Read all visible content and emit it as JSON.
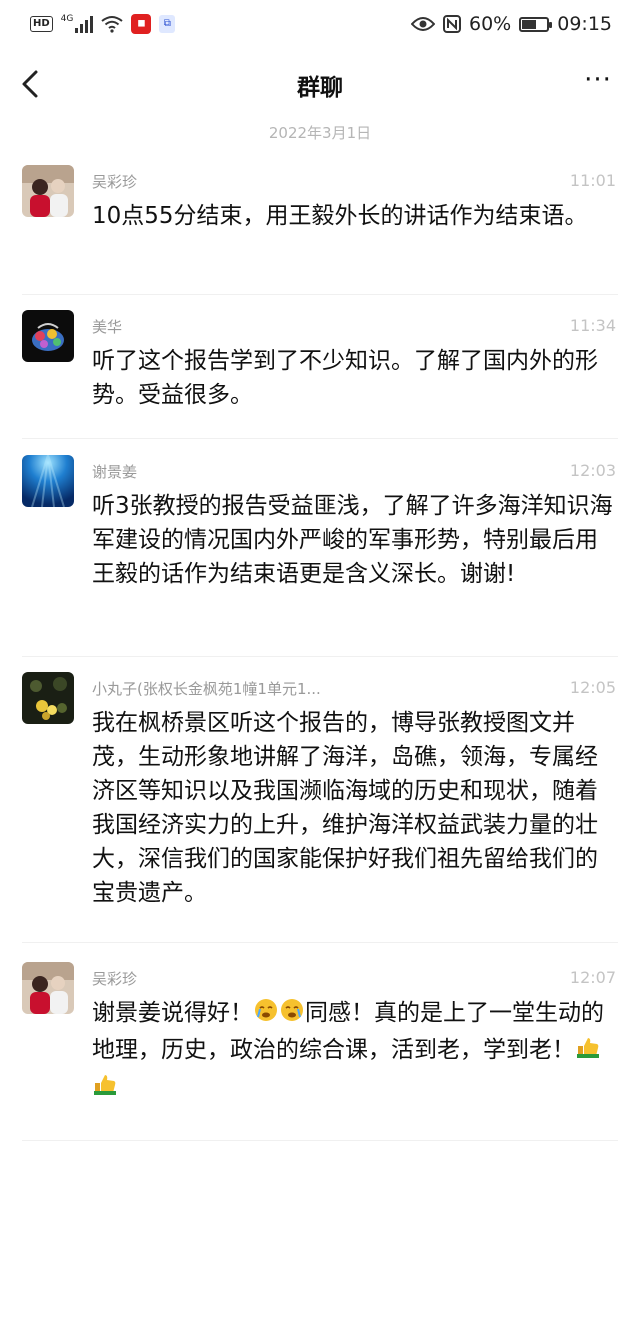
{
  "status_bar": {
    "hd_badge": "HD",
    "network": "4G",
    "battery_pct": "60%",
    "time": "09:15",
    "battery_level": 0.6
  },
  "nav": {
    "title": "群聊",
    "more": "···"
  },
  "date_separator": "2022年3月1日",
  "messages": [
    {
      "sender": "吴彩珍",
      "time": "11:01",
      "text": "10点55分结束，用王毅外长的讲话作为结束语。"
    },
    {
      "sender": "美华",
      "time": "11:34",
      "text": "听了这个报告学到了不少知识。了解了国内外的形势。受益很多。"
    },
    {
      "sender": "谢景姜",
      "time": "12:03",
      "text": "听3张教授的报告受益匪浅，了解了许多海洋知识海军建设的情况国内外严峻的军事形势，特别最后用王毅的话作为结束语更是含义深长。谢谢!"
    },
    {
      "sender": "小丸子(张权长金枫苑1幢1单元1...",
      "time": "12:05",
      "text": "我在枫桥景区听这个报告的，博导张教授图文并茂，生动形象地讲解了海洋，岛礁，领海，专属经济区等知识以及我国濒临海域的历史和现状，随着我国经济实力的上升，维护海洋权益武装力量的壮大，深信我们的国家能保护好我们祖先留给我们的宝贵遗产。"
    },
    {
      "sender": "吴彩珍",
      "time": "12:07",
      "text_part1": "谢景姜说得好！",
      "text_part2": "同感！真的是上了一堂生动的地理，历史，政治的综合课，活到老，学到老！"
    }
  ]
}
